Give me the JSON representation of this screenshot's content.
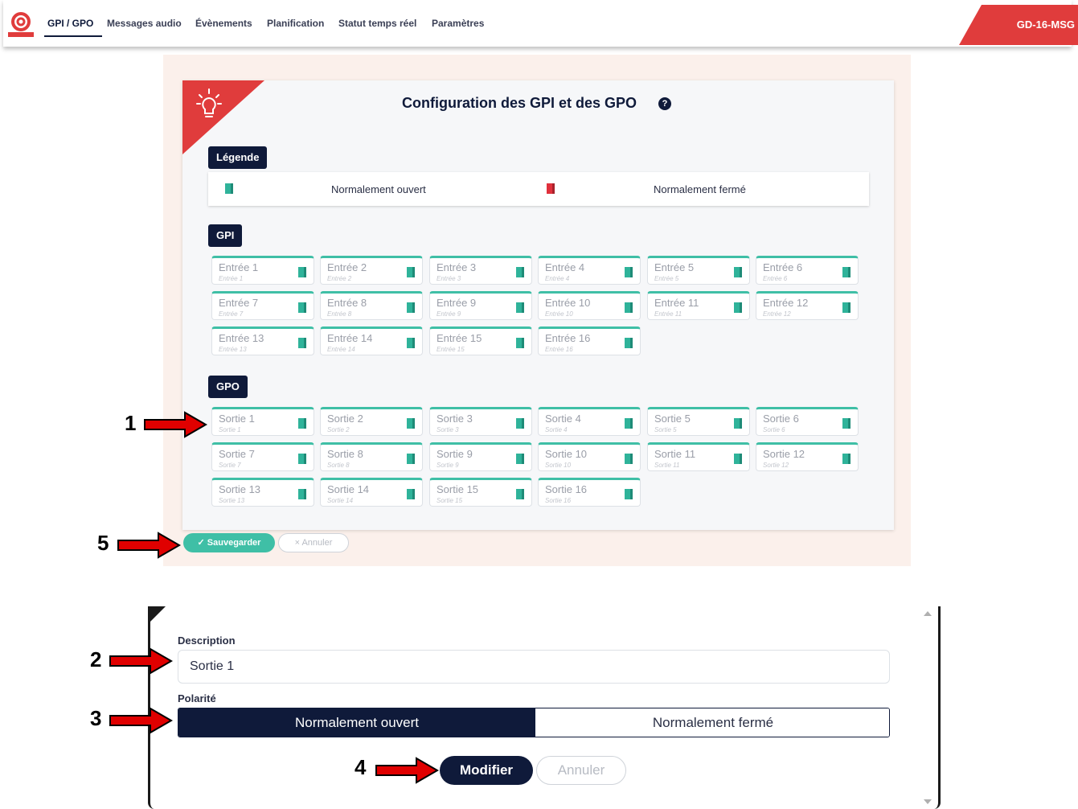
{
  "nav": {
    "logo_text": "ROUVEN",
    "items": [
      {
        "label": "GPI / GPO"
      },
      {
        "label": "Messages audio"
      },
      {
        "label": "Évènements"
      },
      {
        "label": "Planification"
      },
      {
        "label": "Statut temps réel"
      },
      {
        "label": "Paramètres"
      }
    ],
    "device": "GD-16-MSG"
  },
  "config": {
    "title": "Configuration des GPI et des GPO",
    "help": "?",
    "legend_title": "Légende",
    "legend_open": "Normalement ouvert",
    "legend_closed": "Normalement fermé",
    "gpi_title": "GPI",
    "gpo_title": "GPO",
    "gpi": [
      {
        "name": "Entrée 1",
        "sub": "Entrée 1"
      },
      {
        "name": "Entrée 2",
        "sub": "Entrée 2"
      },
      {
        "name": "Entrée 3",
        "sub": "Entrée 3"
      },
      {
        "name": "Entrée 4",
        "sub": "Entrée 4"
      },
      {
        "name": "Entrée 5",
        "sub": "Entrée 5"
      },
      {
        "name": "Entrée 6",
        "sub": "Entrée 6"
      },
      {
        "name": "Entrée 7",
        "sub": "Entrée 7"
      },
      {
        "name": "Entrée 8",
        "sub": "Entrée 8"
      },
      {
        "name": "Entrée 9",
        "sub": "Entrée 9"
      },
      {
        "name": "Entrée 10",
        "sub": "Entrée 10"
      },
      {
        "name": "Entrée 11",
        "sub": "Entrée 11"
      },
      {
        "name": "Entrée 12",
        "sub": "Entrée 12"
      },
      {
        "name": "Entrée 13",
        "sub": "Entrée 13"
      },
      {
        "name": "Entrée 14",
        "sub": "Entrée 14"
      },
      {
        "name": "Entrée 15",
        "sub": "Entrée 15"
      },
      {
        "name": "Entrée 16",
        "sub": "Entrée 16"
      }
    ],
    "gpo": [
      {
        "name": "Sortie 1",
        "sub": "Sortie 1"
      },
      {
        "name": "Sortie 2",
        "sub": "Sortie 2"
      },
      {
        "name": "Sortie 3",
        "sub": "Sortie 3"
      },
      {
        "name": "Sortie 4",
        "sub": "Sortie 4"
      },
      {
        "name": "Sortie 5",
        "sub": "Sortie 5"
      },
      {
        "name": "Sortie 6",
        "sub": "Sortie 6"
      },
      {
        "name": "Sortie 7",
        "sub": "Sortie 7"
      },
      {
        "name": "Sortie 8",
        "sub": "Sortie 8"
      },
      {
        "name": "Sortie 9",
        "sub": "Sortie 9"
      },
      {
        "name": "Sortie 10",
        "sub": "Sortie 10"
      },
      {
        "name": "Sortie 11",
        "sub": "Sortie 11"
      },
      {
        "name": "Sortie 12",
        "sub": "Sortie 12"
      },
      {
        "name": "Sortie 13",
        "sub": "Sortie 13"
      },
      {
        "name": "Sortie 14",
        "sub": "Sortie 14"
      },
      {
        "name": "Sortie 15",
        "sub": "Sortie 15"
      },
      {
        "name": "Sortie 16",
        "sub": "Sortie 16"
      }
    ],
    "save_label": "✓ Sauvegarder",
    "cancel_label": "× Annuler"
  },
  "form": {
    "description_label": "Description",
    "description_value": "Sortie 1",
    "polarity_label": "Polarité",
    "polarity_open": "Normalement ouvert",
    "polarity_closed": "Normalement fermé",
    "modify_label": "Modifier",
    "cancel_label": "Annuler"
  },
  "annotations": [
    "1",
    "2",
    "3",
    "4",
    "5"
  ],
  "colors": {
    "navy": "#0f1a3a",
    "teal": "#3fbfa6",
    "red": "#e03c3c",
    "door_open": "#2fb39a",
    "door_closed": "#e0303c"
  }
}
